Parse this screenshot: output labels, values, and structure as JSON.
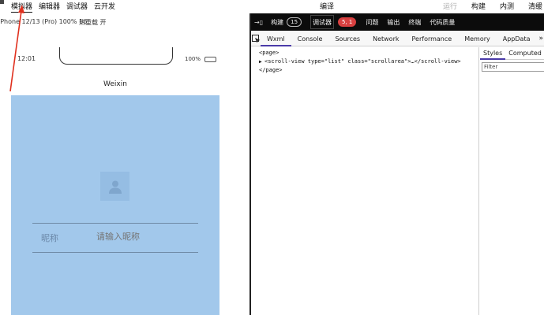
{
  "menu": {
    "simulator": "模拟器",
    "editor": "编辑器",
    "debugger": "调试器",
    "cloud": "云开发",
    "compile": "编译",
    "preview": "运行",
    "build": "构建",
    "test": "内测",
    "clear": "清缓"
  },
  "device": {
    "model": "iPhone 12/13 (Pro) 100% 16",
    "hot_reload": "热重载 开"
  },
  "simulator": {
    "time": "12:01",
    "battery": "100%",
    "nav_title": "Weixin",
    "nickname_label": "昵称",
    "nickname_placeholder": "请输入昵称",
    "page_bg": "#a2c8eb"
  },
  "devtools": {
    "toolbar": {
      "build_label": "构建",
      "build_count": "15",
      "debugger_label": "调试器",
      "debugger_count": "5, 1",
      "issues_label": "问题",
      "output_label": "输出",
      "terminal_label": "终端",
      "quality_label": "代码质量"
    },
    "tabs": [
      "Wxml",
      "Console",
      "Sources",
      "Network",
      "Performance",
      "Memory",
      "AppData"
    ],
    "more": "»",
    "dom": {
      "line1": "<page>",
      "line2": "<scroll-view type=\"list\" class=\"scrollarea\">…</scroll-view>",
      "line3": "</page>"
    },
    "side_tabs": [
      "Styles",
      "Computed"
    ],
    "filter_placeholder": "Filter"
  },
  "colors": {
    "accent_tab": "#4a3aa8",
    "badge_red": "#d84040",
    "arrow": "#e0301e"
  },
  "icons": {
    "inspect": "cursor-inspect-icon",
    "avatar": "person-icon",
    "battery": "battery-icon",
    "tree_toggle": "triangle-right-icon"
  }
}
